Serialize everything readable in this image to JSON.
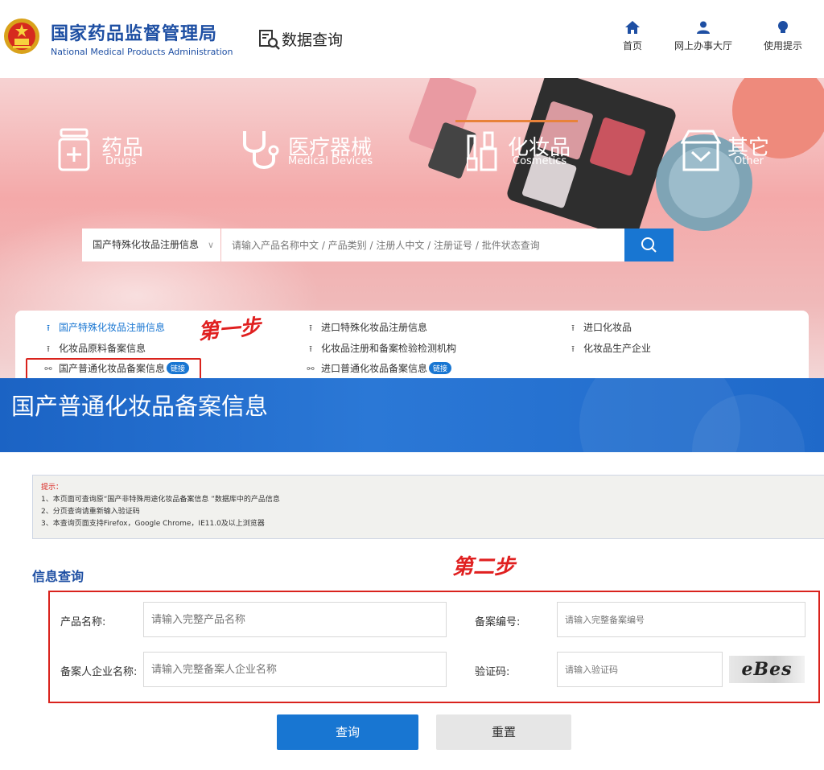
{
  "header": {
    "brand_cn": "国家药品监督管理局",
    "brand_en": "National Medical Products Administration",
    "data_query_label": "数据查询",
    "nav": [
      {
        "label": "首页",
        "icon": "home-icon"
      },
      {
        "label": "网上办事大厅",
        "icon": "user-icon"
      },
      {
        "label": "使用提示",
        "icon": "lightbulb-icon"
      }
    ]
  },
  "banner": {
    "categories": [
      {
        "cn": "药品",
        "en": "Drugs",
        "icon": "drug-icon"
      },
      {
        "cn": "医疗器械",
        "en": "Medical Devices",
        "icon": "stethoscope-icon"
      },
      {
        "cn": "化妆品",
        "en": "Cosmetics",
        "icon": "cosmetics-icon",
        "active": true
      },
      {
        "cn": "其它",
        "en": "Other",
        "icon": "store-icon"
      }
    ],
    "search": {
      "selected_option": "国产特殊化妆品注册信息",
      "placeholder": "请输入产品名称中文 / 产品类别 / 注册人中文 / 注册证号 / 批件状态查询"
    },
    "links": [
      {
        "label": "国产特殊化妆品注册信息",
        "active": true
      },
      {
        "label": "进口特殊化妆品注册信息"
      },
      {
        "label": "进口化妆品"
      },
      {
        "label": "化妆品原料备案信息"
      },
      {
        "label": "化妆品注册和备案检验检测机构"
      },
      {
        "label": "化妆品生产企业"
      },
      {
        "label": "国产普通化妆品备案信息",
        "badge": "链接"
      },
      {
        "label": "进口普通化妆品备案信息",
        "badge": "链接"
      }
    ],
    "step1_label": "第一步"
  },
  "page_title": "国产普通化妆品备案信息",
  "tips": {
    "title": "提示：",
    "lines": [
      "1、本页面可查询原“国产非特殊用途化妆品备案信息 ”数据库中的产品信息",
      "2、分页查询请重新输入验证码",
      "3、本查询页面支持Firefox，Google Chrome，IE11.0及以上浏览器"
    ]
  },
  "query": {
    "section_title": "信息查询",
    "step2_label": "第二步",
    "fields": {
      "product_name": {
        "label": "产品名称:",
        "placeholder": "请输入完整产品名称"
      },
      "record_no": {
        "label": "备案编号:",
        "placeholder": "请输入完整备案编号"
      },
      "company_name": {
        "label": "备案人企业名称:",
        "placeholder": "请输入完整备案人企业名称"
      },
      "captcha": {
        "label": "验证码:",
        "placeholder": "请输入验证码",
        "image_text": "eBes"
      }
    },
    "query_button": "查询",
    "reset_button": "重置"
  },
  "colors": {
    "brand_blue": "#1e4fa3",
    "accent_blue": "#1876d2",
    "highlight_red": "#d9231d",
    "active_underline": "#e8823a"
  }
}
